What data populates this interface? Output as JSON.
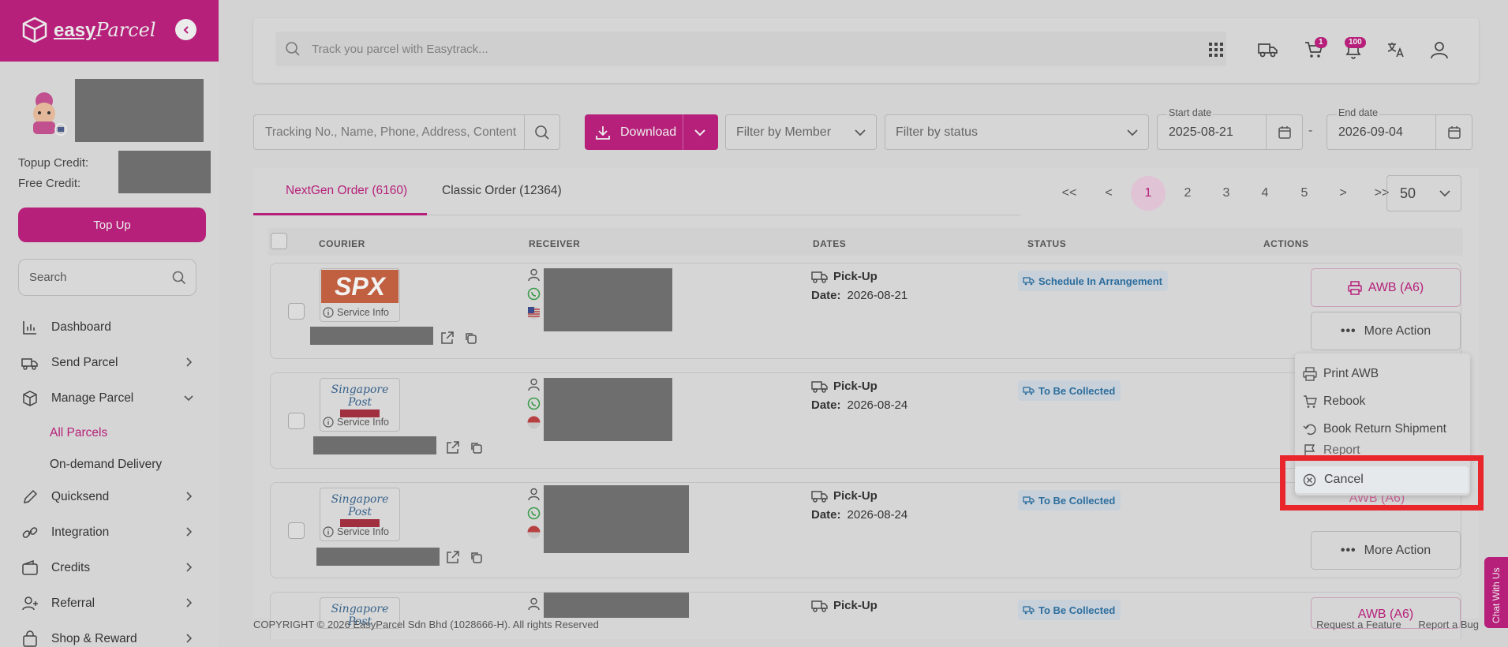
{
  "brand": {
    "name_bold": "easy",
    "name_script": "Parcel"
  },
  "sidebar": {
    "topup_credit_label": "Topup Credit:",
    "free_credit_label": "Free Credit:",
    "topup_button": "Top Up",
    "search_placeholder": "Search",
    "items": [
      {
        "label": "Dashboard",
        "icon": "bar-chart-icon"
      },
      {
        "label": "Send Parcel",
        "icon": "truck-icon"
      },
      {
        "label": "Manage Parcel",
        "icon": "box-icon"
      },
      {
        "label": "All Parcels"
      },
      {
        "label": "On-demand Delivery"
      },
      {
        "label": "Quicksend",
        "icon": "pen-icon"
      },
      {
        "label": "Integration",
        "icon": "link-icon"
      },
      {
        "label": "Credits",
        "icon": "wallet-icon"
      },
      {
        "label": "Referral",
        "icon": "user-plus-icon"
      },
      {
        "label": "Shop & Reward",
        "icon": "shopping-bag-icon"
      }
    ]
  },
  "topbar": {
    "track_placeholder": "Track you parcel with Easytrack...",
    "cart_badge": "1",
    "notif_badge": "100"
  },
  "filters": {
    "search_placeholder": "Tracking No., Name, Phone, Address, Content",
    "download_label": "Download",
    "member_placeholder": "Filter by Member",
    "status_placeholder": "Filter by status",
    "start_label": "Start date",
    "start_value": "2025-08-21",
    "end_label": "End date",
    "end_value": "2026-09-04",
    "separator": "-"
  },
  "tabs": [
    {
      "label": "NextGen Order (6160)"
    },
    {
      "label": "Classic Order (12364)"
    }
  ],
  "pagination": {
    "first": "<<",
    "prev": "<",
    "pages": [
      "1",
      "2",
      "3",
      "4",
      "5"
    ],
    "next": ">",
    "last": ">>",
    "per_page": "50"
  },
  "table": {
    "headers": [
      "COURIER",
      "RECEIVER",
      "DATES",
      "STATUS",
      "ACTIONS"
    ],
    "service_info": "Service Info",
    "pickup_label": "Pick-Up",
    "date_label": "Date:",
    "rows": [
      {
        "courier": "SPX",
        "date": "2026-08-21",
        "status": "Schedule In Arrangement"
      },
      {
        "courier": "Singapore Post",
        "date": "2026-08-24",
        "status": "To Be Collected"
      },
      {
        "courier": "Singapore Post",
        "date": "2026-08-24",
        "status": "To Be Collected"
      },
      {
        "courier": "Singapore Post",
        "status": "To Be Collected"
      }
    ],
    "awb_label": "AWB (A6)",
    "more_label": "More Action"
  },
  "menu": {
    "items": [
      "Print AWB",
      "Rebook",
      "Book Return Shipment",
      "Report",
      "Cancel"
    ]
  },
  "footer": {
    "copyright": "COPYRIGHT © 2026 EasyParcel Sdn Bhd (1028666-H). All rights Reserved",
    "request_feature": "Request a Feature",
    "report_bug": "Report a Bug"
  },
  "chat_label": "Chat With Us",
  "colors": {
    "brand": "#b6207a",
    "status_text": "#2c6d9c",
    "highlight": "#e8262c"
  }
}
